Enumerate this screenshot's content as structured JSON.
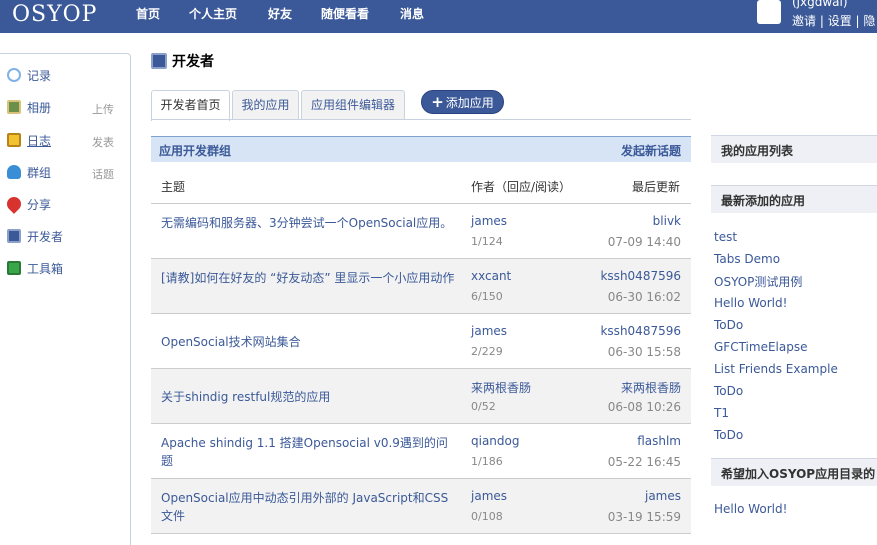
{
  "header": {
    "logo": "OSYOP",
    "nav": [
      "首页",
      "个人主页",
      "好友",
      "随便看看",
      "消息"
    ],
    "user_name": "(jxgdwal)",
    "user_links": [
      "邀请",
      "设置",
      "隐"
    ],
    "separator": " | "
  },
  "sidebar": {
    "items": [
      {
        "label": "记录",
        "extra": "",
        "icon": "speech-bubble-icon"
      },
      {
        "label": "相册",
        "extra": "上传",
        "icon": "photo-icon"
      },
      {
        "label": "日志",
        "extra": "发表",
        "icon": "notebook-icon"
      },
      {
        "label": "群组",
        "extra": "话题",
        "icon": "group-icon"
      },
      {
        "label": "分享",
        "extra": "",
        "icon": "heart-icon"
      },
      {
        "label": "开发者",
        "extra": "",
        "icon": "developer-icon"
      },
      {
        "label": "工具箱",
        "extra": "",
        "icon": "toolbox-icon"
      }
    ]
  },
  "page": {
    "title": "开发者",
    "tabs": [
      "开发者首页",
      "我的应用",
      "应用组件编辑器"
    ],
    "add_app": "添加应用"
  },
  "group": {
    "title": "应用开发群组",
    "new_topic": "发起新话题",
    "columns": [
      "主题",
      "作者（回应/阅读）",
      "最后更新"
    ],
    "rows": [
      {
        "topic": "无需编码和服务器、3分钟尝试一个OpenSocial应用。",
        "author": "james",
        "stats": "1/124",
        "last_user": "blivk",
        "time": "07-09 14:40"
      },
      {
        "topic": "[请教]如何在好友的 “好友动态” 里显示一个小应用动作",
        "author": "xxcant",
        "stats": "6/150",
        "last_user": "kssh0487596",
        "time": "06-30 16:02"
      },
      {
        "topic": "OpenSocial技术网站集合",
        "author": "james",
        "stats": "2/229",
        "last_user": "kssh0487596",
        "time": "06-30 15:58"
      },
      {
        "topic": "关于shindig restful规范的应用",
        "author": "来两根香肠",
        "stats": "0/52",
        "last_user": "来两根香肠",
        "time": "06-08 10:26"
      },
      {
        "topic": "Apache shindig 1.1 搭建Opensocial v0.9遇到的问题",
        "author": "qiandog",
        "stats": "1/186",
        "last_user": "flashlm",
        "time": "05-22 16:45"
      },
      {
        "topic": "OpenSocial应用中动态引用外部的 JavaScript和CSS文件",
        "author": "james",
        "stats": "0/108",
        "last_user": "james",
        "time": "03-19 15:59"
      }
    ]
  },
  "right": {
    "my_apps_title": "我的应用列表",
    "latest_title": "最新添加的应用",
    "latest_apps": [
      "test",
      "Tabs Demo",
      "OSYOP测试用例",
      "Hello World!",
      "ToDo",
      "GFCTimeElapse",
      "List Friends Example",
      "ToDo",
      "T1",
      "ToDo"
    ],
    "join_title": "希望加入OSYOP应用目录的",
    "join_apps": [
      "Hello World!"
    ]
  },
  "colors": {
    "brand": "#3b5998",
    "group_header": "#d7e4f5"
  }
}
